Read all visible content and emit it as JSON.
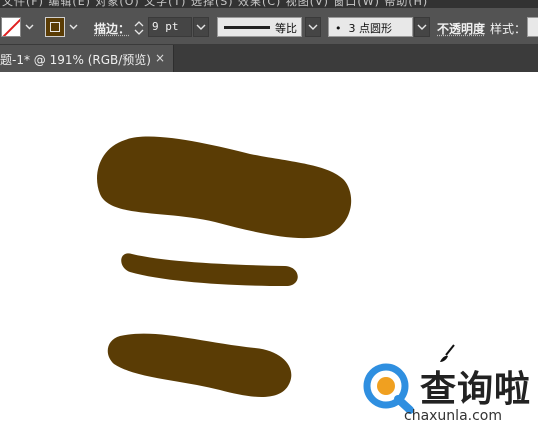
{
  "menubar": {
    "text": "文件(F)  编辑(E)  对象(O)  文字(T)  选择(S)  效果(C)  视图(V)  窗口(W)  帮助(H)"
  },
  "controlbar": {
    "stroke_label": "描边：",
    "stroke_weight": "9 pt",
    "profile_label": "等比",
    "brush_label": "•  3 点圆形",
    "opacity_label": "不透明度",
    "style_label": "样式："
  },
  "tabbar": {
    "doc_tab_title": "题-1* @ 191% (RGB/预览)",
    "close_symbol": "×"
  },
  "canvas": {
    "stroke_color": "#5a3c05",
    "shapes": [
      "thick-brush-stroke",
      "thin-brush-stroke",
      "medium-brush-stroke"
    ]
  },
  "watermark": {
    "text": "查询啦",
    "url": "chaxunla.com",
    "accent_color": "#2f8fe0"
  }
}
